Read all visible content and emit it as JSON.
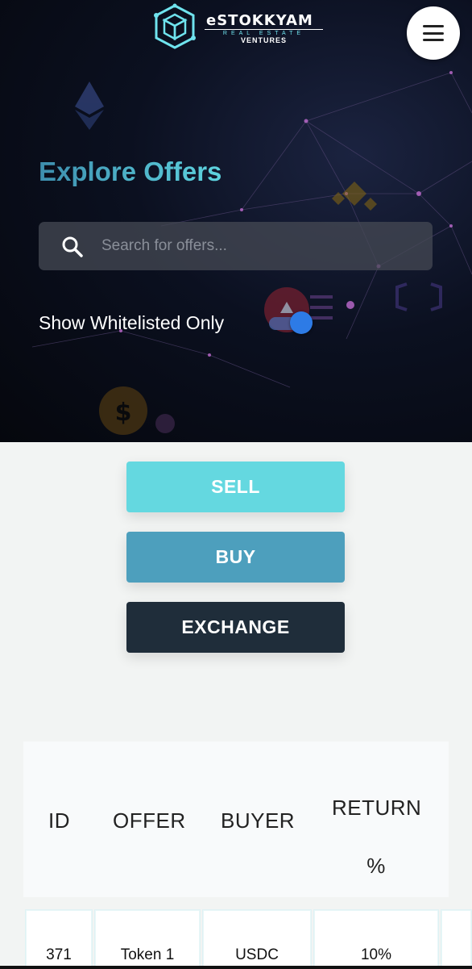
{
  "brand": {
    "name": "eSTOKKYAM",
    "tagline": "REAL ESTATE",
    "subtitle": "VENTURES"
  },
  "header": {
    "menu_icon": "hamburger-menu-icon"
  },
  "hero": {
    "title": "Explore Offers",
    "search_placeholder": "Search for offers...",
    "search_icon": "search-icon",
    "whitelist_label": "Show Whitelisted Only",
    "whitelist_toggle_on": true
  },
  "actions": {
    "sell": "SELL",
    "buy": "BUY",
    "exchange": "EXCHANGE"
  },
  "table": {
    "headers": [
      "ID",
      "OFFER",
      "BUYER",
      "RETURN %"
    ],
    "rows": [
      [
        "371",
        "Token 1",
        "USDC",
        "10%"
      ]
    ]
  },
  "colors": {
    "sell": "#64d8e0",
    "buy": "#4d9fbd",
    "exchange": "#1f2d3a",
    "accent": "#5ed4e0"
  }
}
